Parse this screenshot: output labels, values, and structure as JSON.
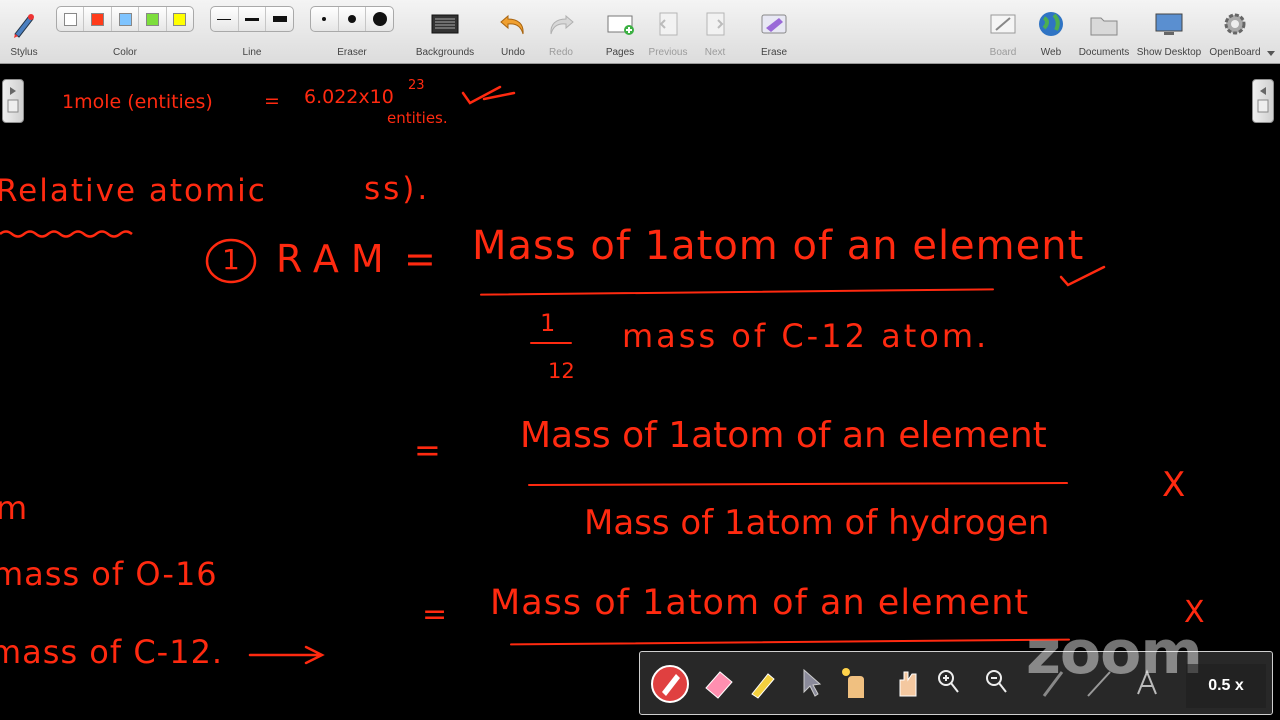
{
  "toolbar": {
    "stylus_label": "Stylus",
    "color_label": "Color",
    "line_label": "Line",
    "eraser_label": "Eraser",
    "backgrounds_label": "Backgrounds",
    "undo_label": "Undo",
    "redo_label": "Redo",
    "pages_label": "Pages",
    "previous_label": "Previous",
    "next_label": "Next",
    "erase_label": "Erase",
    "board_label": "Board",
    "web_label": "Web",
    "documents_label": "Documents",
    "show_desktop_label": "Show Desktop",
    "openboard_label": "OpenBoard",
    "colors": [
      "#ffffff",
      "#ff3b1a",
      "#7fc4ff",
      "#7dde3c",
      "#ffff00"
    ]
  },
  "board": {
    "ink_color": "#ff2a10",
    "line1_left": "1mole (entities)",
    "line1_eq": "=",
    "line1_value": "6.022x10",
    "line1_exp": "23",
    "line1_entities": "entities.",
    "heading": "Relative atomic",
    "heading_tail": "ss).",
    "ram_number": "1",
    "ram_label": "RAM",
    "ram_eq": "=",
    "f1_numerator": "Mass of 1atom of an element",
    "f1_den_top": "1",
    "f1_den_bottom": "12",
    "f1_denominator": "mass of C-12 atom.",
    "f2_eq": "=",
    "f2_numerator": "Mass of 1atom of an element",
    "f2_denominator": "Mass of 1atom of hydrogen",
    "f2_mark": "X",
    "f3_eq": "=",
    "f3_numerator": "Mass of 1atom of an element",
    "f3_mark": "X",
    "left_m": "m",
    "left_o16": "mass of O-16",
    "left_c12": "mass of C-12."
  },
  "zoom": {
    "logo": "zoom",
    "speed": "0.5 x"
  }
}
